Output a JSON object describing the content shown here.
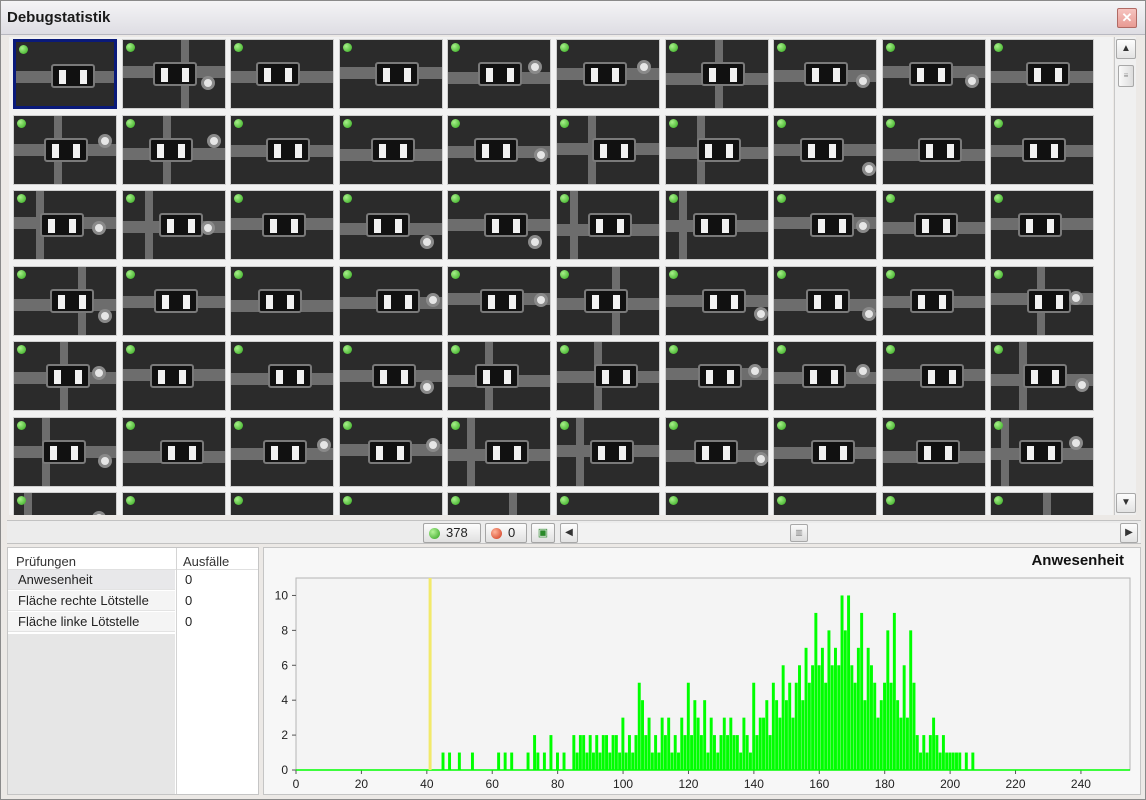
{
  "window": {
    "title": "Debugstatistik",
    "close_label": "✕"
  },
  "grid": {
    "rows": 7,
    "cols": 10,
    "selected_index": 0
  },
  "status": {
    "pass_count": "378",
    "fail_count": "0"
  },
  "inspections": {
    "header_name": "Prüfungen",
    "header_failures": "Ausfälle",
    "rows": [
      {
        "name": "Anwesenheit",
        "failures": "0"
      },
      {
        "name": "Fläche rechte Lötstelle",
        "failures": "0"
      },
      {
        "name": "Fläche linke Lötstelle",
        "failures": "0"
      }
    ]
  },
  "chart_data": {
    "type": "bar",
    "title": "Anwesenheit",
    "xlim": [
      0,
      255
    ],
    "ylim": [
      0,
      11
    ],
    "xticks": [
      0,
      20,
      40,
      60,
      80,
      100,
      120,
      140,
      160,
      180,
      200,
      220,
      240
    ],
    "yticks": [
      0,
      2,
      4,
      6,
      8,
      10
    ],
    "threshold": 41,
    "bar_color": "#00ff00",
    "threshold_color": "#f2e96a",
    "x": [
      45,
      47,
      50,
      54,
      62,
      64,
      66,
      71,
      73,
      74,
      76,
      78,
      80,
      82,
      85,
      86,
      87,
      88,
      89,
      90,
      91,
      92,
      93,
      94,
      95,
      96,
      97,
      98,
      99,
      100,
      101,
      102,
      103,
      104,
      105,
      106,
      107,
      108,
      109,
      110,
      111,
      112,
      113,
      114,
      115,
      116,
      117,
      118,
      119,
      120,
      121,
      122,
      123,
      124,
      125,
      126,
      127,
      128,
      129,
      130,
      131,
      132,
      133,
      134,
      135,
      136,
      137,
      138,
      139,
      140,
      141,
      142,
      143,
      144,
      145,
      146,
      147,
      148,
      149,
      150,
      151,
      152,
      153,
      154,
      155,
      156,
      157,
      158,
      159,
      160,
      161,
      162,
      163,
      164,
      165,
      166,
      167,
      168,
      169,
      170,
      171,
      172,
      173,
      174,
      175,
      176,
      177,
      178,
      179,
      180,
      181,
      182,
      183,
      184,
      185,
      186,
      187,
      188,
      189,
      190,
      191,
      192,
      193,
      194,
      195,
      196,
      197,
      198,
      199,
      200,
      201,
      202,
      203,
      205,
      207
    ],
    "values": [
      1,
      1,
      1,
      1,
      1,
      1,
      1,
      1,
      2,
      1,
      1,
      2,
      1,
      1,
      2,
      1,
      2,
      2,
      1,
      2,
      1,
      2,
      1,
      2,
      2,
      1,
      2,
      2,
      1,
      3,
      1,
      2,
      1,
      2,
      5,
      4,
      2,
      3,
      1,
      2,
      1,
      3,
      2,
      3,
      1,
      2,
      1,
      3,
      2,
      5,
      2,
      4,
      3,
      2,
      4,
      1,
      3,
      2,
      1,
      2,
      3,
      2,
      3,
      2,
      2,
      1,
      3,
      2,
      1,
      5,
      2,
      3,
      3,
      4,
      2,
      5,
      4,
      3,
      6,
      4,
      5,
      3,
      5,
      6,
      4,
      7,
      5,
      6,
      9,
      6,
      7,
      5,
      8,
      6,
      7,
      6,
      10,
      8,
      10,
      6,
      5,
      7,
      9,
      4,
      7,
      6,
      5,
      3,
      4,
      5,
      8,
      5,
      9,
      4,
      3,
      6,
      3,
      8,
      5,
      2,
      1,
      2,
      1,
      2,
      3,
      2,
      1,
      2,
      1,
      1,
      1,
      1,
      1,
      1,
      1
    ]
  }
}
